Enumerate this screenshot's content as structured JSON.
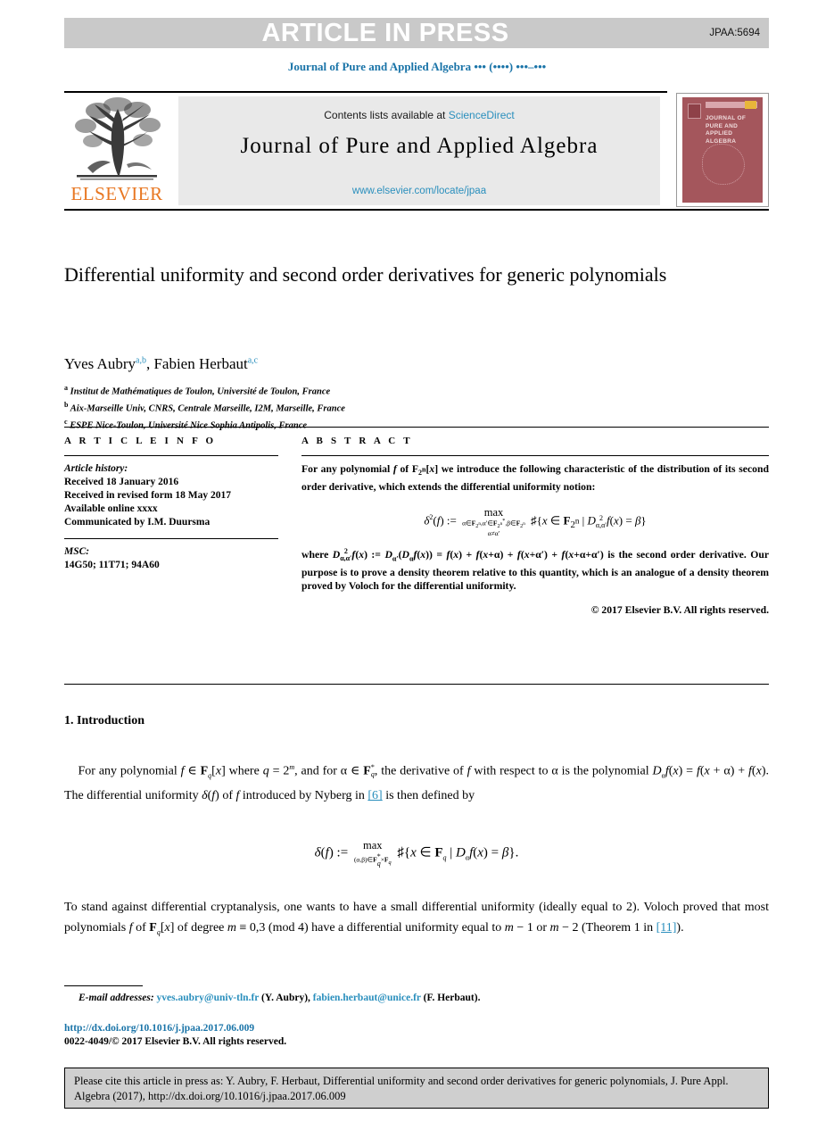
{
  "banner": {
    "text": "ARTICLE IN PRESS",
    "code": "JPAA:5694",
    "bg_color": "#c9c9c9"
  },
  "running_head": {
    "journal": "Journal of Pure and Applied Algebra",
    "volume_placeholder": "•••",
    "issue_placeholder": "(••••)",
    "pages_placeholder": "•••–•••",
    "color": "#1a74a8"
  },
  "masthead": {
    "contents_prefix": "Contents lists available at",
    "contents_link": "ScienceDirect",
    "journal_title": "Journal of Pure and Applied Algebra",
    "journal_url": "www.elsevier.com/locate/jpaa",
    "publisher": "ELSEVIER",
    "publisher_color": "#e87722",
    "link_color": "#2a8fbd",
    "cover": {
      "line1": "JOURNAL OF",
      "line2": "PURE AND",
      "line3": "APPLIED ALGEBRA",
      "bg_color": "#a4565c"
    }
  },
  "article": {
    "title": "Differential uniformity and second order derivatives for generic polynomials",
    "authors": [
      {
        "name": "Yves Aubry",
        "marks": "a,b"
      },
      {
        "name": "Fabien Herbaut",
        "marks": "a,c"
      }
    ],
    "affiliations": [
      {
        "mark": "a",
        "text": "Institut de Mathématiques de Toulon, Université de Toulon, France"
      },
      {
        "mark": "b",
        "text": "Aix-Marseille Univ, CNRS, Centrale Marseille, I2M, Marseille, France"
      },
      {
        "mark": "c",
        "text": "ESPE Nice-Toulon, Université Nice Sophia Antipolis, France"
      }
    ]
  },
  "info": {
    "heading": "A R T I C L E   I N F O",
    "history_label": "Article history:",
    "history": [
      "Received 18 January 2016",
      "Received in revised form 18 May 2017",
      "Available online xxxx",
      "Communicated by I.M. Duursma"
    ],
    "msc_label": "MSC:",
    "msc_codes": "14G50; 11T71; 94A60"
  },
  "abstract": {
    "heading": "A B S T R A C T",
    "para1": "For any polynomial f of F2n[x] we introduce the following characteristic of the distribution of its second order derivative, which extends the differential uniformity notion:",
    "para2": "where D2α,α' f(x) := Dα'(Dα f(x)) = f(x) + f(x+α) + f(x+α') + f(x+α+α') is the second order derivative. Our purpose is to prove a density theorem relative to this quantity, which is an analogue of a density theorem proved by Voloch for the differential uniformity.",
    "copyright": "© 2017 Elsevier B.V. All rights reserved."
  },
  "body": {
    "section_title": "1. Introduction",
    "para1": "For any polynomial f ∈ Fq[x] where q = 2m, and for α ∈ Fq*, the derivative of f with respect to α is the polynomial Dα f(x) = f(x+α) + f(x). The differential uniformity δ(f) of f introduced by Nyberg in [6] is then defined by",
    "para2": "To stand against differential cryptanalysis, one wants to have a small differential uniformity (ideally equal to 2). Voloch proved that most polynomials f of Fq[x] of degree m ≡ 0,3 (mod 4) have a differential uniformity equal to m − 1 or m − 2 (Theorem 1 in [11]).",
    "ref_nyberg": "[6]",
    "ref_voloch": "[11]"
  },
  "footnote": {
    "emails_label": "E-mail addresses:",
    "email1": "yves.aubry@univ-tln.fr",
    "email1_author": "(Y. Aubry),",
    "email2": "fabien.herbaut@unice.fr",
    "email2_author": "(F. Herbaut).",
    "doi": "http://dx.doi.org/10.1016/j.jpaa.2017.06.009",
    "issn": "0022-4049/© 2017 Elsevier B.V. All rights reserved."
  },
  "cite_box": {
    "text": "Please cite this article in press as: Y. Aubry, F. Herbaut, Differential uniformity and second order derivatives for generic polynomials, J. Pure Appl. Algebra (2017), http://dx.doi.org/10.1016/j.jpaa.2017.06.009"
  }
}
